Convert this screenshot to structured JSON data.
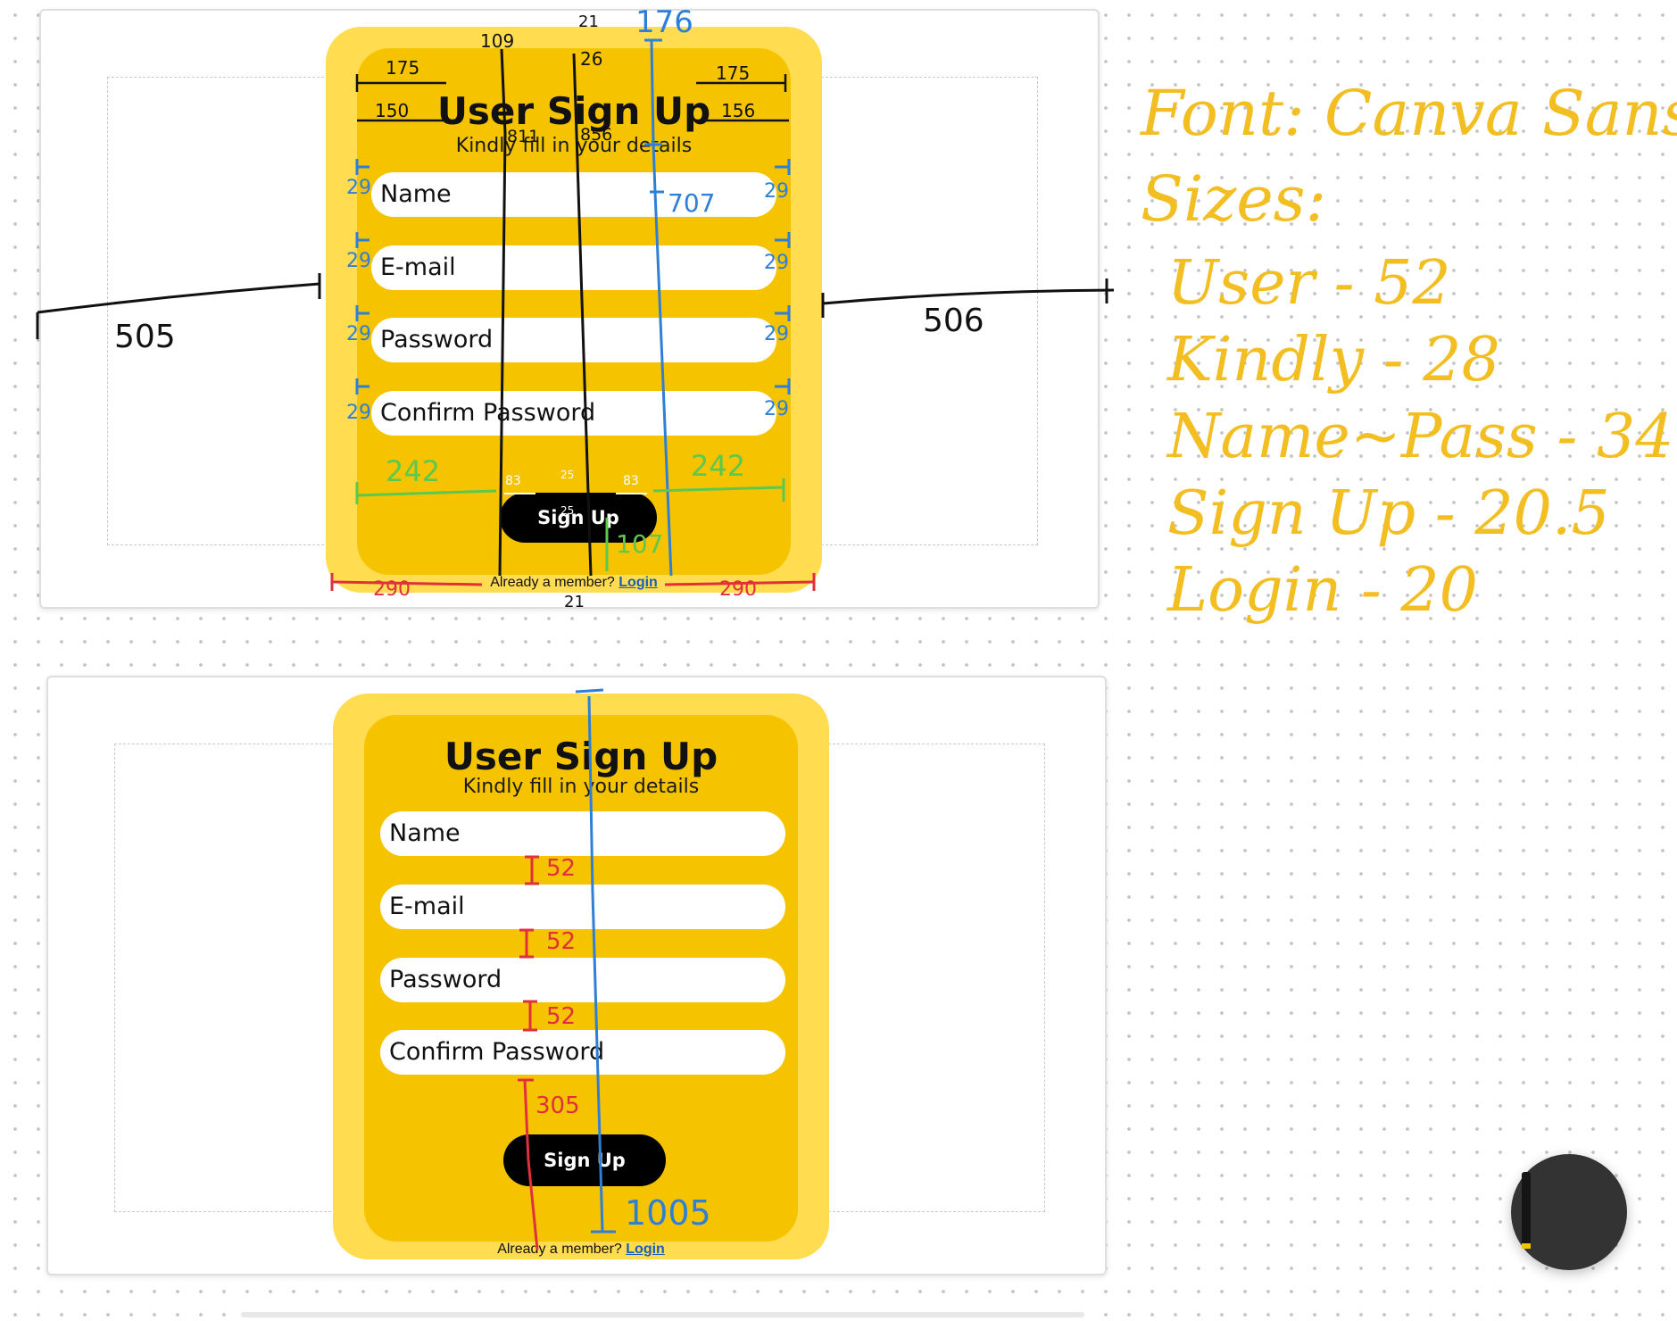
{
  "signup": {
    "title": "User Sign Up",
    "subtitle": "Kindly fill in your details",
    "fields": [
      {
        "placeholder": "Name"
      },
      {
        "placeholder": "E-mail"
      },
      {
        "placeholder": "Password"
      },
      {
        "placeholder": "Confirm Password"
      }
    ],
    "button_label": "Sign Up",
    "footer_text": "Already a member?",
    "login_label": "Login"
  },
  "annotations": {
    "outer_margin_left": "505",
    "outer_margin_right": "506",
    "title_margin_left": "175",
    "title_margin_right": "175",
    "subtitle_margin_left": "150",
    "subtitle_margin_right": "156",
    "field_side_spacing": "29",
    "button_margin_left": "242",
    "button_margin_right": "242",
    "button_padding_left": "83",
    "button_padding_right": "83",
    "button_padding_top": "25",
    "button_padding_bottom": "25",
    "card_top_offset": "21",
    "card_bottom_offset": "21",
    "inner_top_offset": "26",
    "left_measure": "109",
    "card_height": "176",
    "form_height": "707",
    "button_gap": "107",
    "footer_left": "290",
    "footer_right": "290",
    "inner_left_marker": "811",
    "inner_right_marker": "856",
    "field_gaps": [
      "52",
      "52",
      "52"
    ],
    "lower_gap": "305",
    "inner_height": "1005"
  },
  "notes": {
    "font_line": "Font: Canva Sans",
    "sizes_line": "Sizes:",
    "items": [
      "User - 52",
      "Kindly - 28",
      "Name~Pass - 34",
      "Sign Up - 20.5",
      "Login - 20"
    ]
  },
  "colors": {
    "card_outer": "#FFDC50",
    "card_inner": "#F5C300",
    "button": "#000000",
    "login_link": "#1a5fb4",
    "note_ink": "#F2BE22",
    "measure_blue": "#2F7FD6",
    "measure_red": "#E0303A",
    "measure_green": "#5CC94E"
  }
}
